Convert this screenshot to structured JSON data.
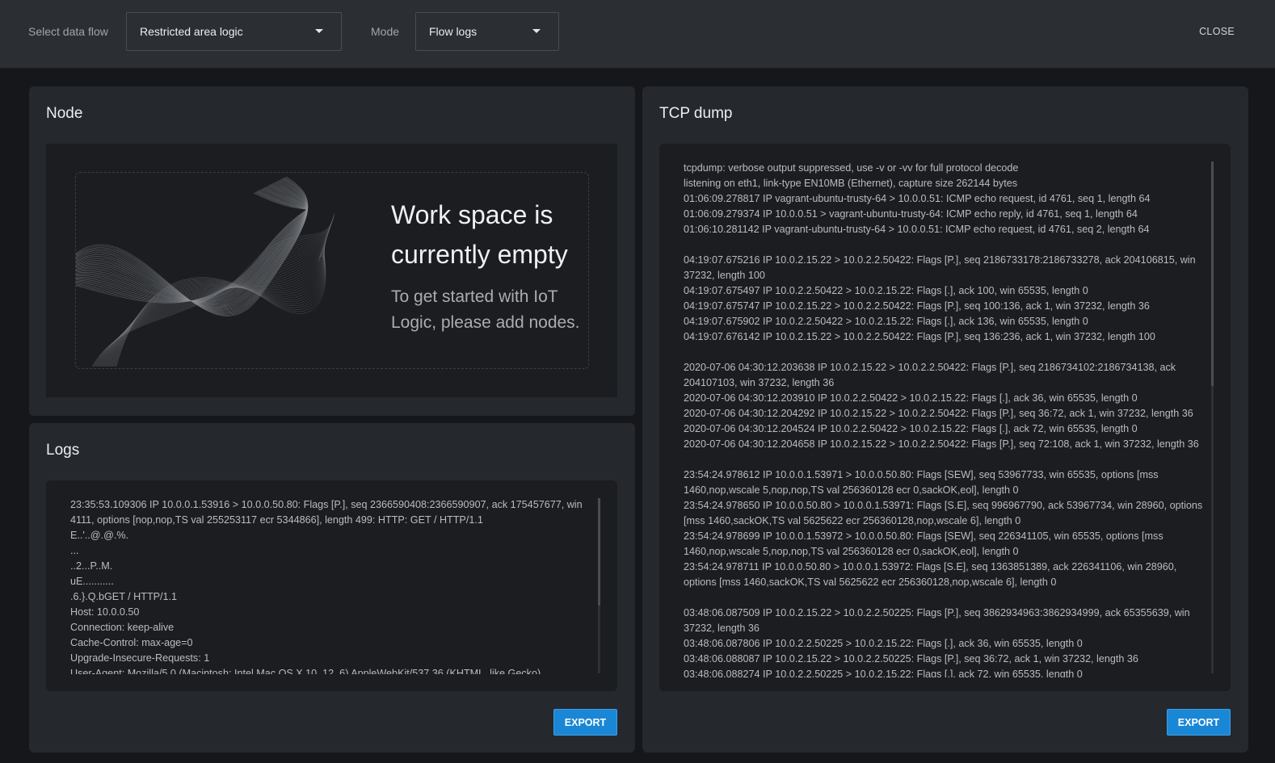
{
  "topbar": {
    "data_flow_label": "Select data flow",
    "data_flow_value": "Restricted area logic",
    "mode_label": "Mode",
    "mode_value": "Flow logs",
    "close_label": "CLOSE"
  },
  "node_panel": {
    "title": "Node",
    "empty_title": "Work space is currently empty",
    "empty_subtitle": "To get started with IoT Logic, please add nodes."
  },
  "logs_panel": {
    "title": "Logs",
    "content": "23:35:53.109306 IP 10.0.0.1.53916 > 10.0.0.50.80: Flags [P.], seq 2366590408:2366590907, ack 175457677, win 4111, options [nop,nop,TS val 255253117 ecr 5344866], length 499: HTTP: GET / HTTP/1.1\nE..'..@.@.%.\n...\n..2...P..M.\nuE...........\n.6.}.Q.bGET / HTTP/1.1\nHost: 10.0.0.50\nConnection: keep-alive\nCache-Control: max-age=0\nUpgrade-Insecure-Requests: 1\nUser-Agent: Mozilla/5.0 (Macintosh; Intel Mac OS X 10_12_6) AppleWebKit/537.36 (KHTML, like Gecko)",
    "export_label": "EXPORT"
  },
  "tcp_panel": {
    "title": "TCP dump",
    "content": "tcpdump: verbose output suppressed, use -v or -vv for full protocol decode\nlistening on eth1, link-type EN10MB (Ethernet), capture size 262144 bytes\n01:06:09.278817 IP vagrant-ubuntu-trusty-64 > 10.0.0.51: ICMP echo request, id 4761, seq 1, length 64\n01:06:09.279374 IP 10.0.0.51 > vagrant-ubuntu-trusty-64: ICMP echo reply, id 4761, seq 1, length 64\n01:06:10.281142 IP vagrant-ubuntu-trusty-64 > 10.0.0.51: ICMP echo request, id 4761, seq 2, length 64\n\n04:19:07.675216 IP 10.0.2.15.22 > 10.0.2.2.50422: Flags [P.], seq 2186733178:2186733278, ack 204106815, win 37232, length 100\n04:19:07.675497 IP 10.0.2.2.50422 > 10.0.2.15.22: Flags [.], ack 100, win 65535, length 0\n04:19:07.675747 IP 10.0.2.15.22 > 10.0.2.2.50422: Flags [P.], seq 100:136, ack 1, win 37232, length 36\n04:19:07.675902 IP 10.0.2.2.50422 > 10.0.2.15.22: Flags [.], ack 136, win 65535, length 0\n04:19:07.676142 IP 10.0.2.15.22 > 10.0.2.2.50422: Flags [P.], seq 136:236, ack 1, win 37232, length 100\n\n2020-07-06 04:30:12.203638 IP 10.0.2.15.22 > 10.0.2.2.50422: Flags [P.], seq 2186734102:2186734138, ack 204107103, win 37232, length 36\n2020-07-06 04:30:12.203910 IP 10.0.2.2.50422 > 10.0.2.15.22: Flags [.], ack 36, win 65535, length 0\n2020-07-06 04:30:12.204292 IP 10.0.2.15.22 > 10.0.2.2.50422: Flags [P.], seq 36:72, ack 1, win 37232, length 36\n2020-07-06 04:30:12.204524 IP 10.0.2.2.50422 > 10.0.2.15.22: Flags [.], ack 72, win 65535, length 0\n2020-07-06 04:30:12.204658 IP 10.0.2.15.22 > 10.0.2.2.50422: Flags [P.], seq 72:108, ack 1, win 37232, length 36\n\n23:54:24.978612 IP 10.0.0.1.53971 > 10.0.0.50.80: Flags [SEW], seq 53967733, win 65535, options [mss 1460,nop,wscale 5,nop,nop,TS val 256360128 ecr 0,sackOK,eol], length 0\n23:54:24.978650 IP 10.0.0.50.80 > 10.0.0.1.53971: Flags [S.E], seq 996967790, ack 53967734, win 28960, options [mss 1460,sackOK,TS val 5625622 ecr 256360128,nop,wscale 6], length 0\n23:54:24.978699 IP 10.0.0.1.53972 > 10.0.0.50.80: Flags [SEW], seq 226341105, win 65535, options [mss 1460,nop,wscale 5,nop,nop,TS val 256360128 ecr 0,sackOK,eol], length 0\n23:54:24.978711 IP 10.0.0.50.80 > 10.0.0.1.53972: Flags [S.E], seq 1363851389, ack 226341106, win 28960, options [mss 1460,sackOK,TS val 5625622 ecr 256360128,nop,wscale 6], length 0\n\n03:48:06.087509 IP 10.0.2.15.22 > 10.0.2.2.50225: Flags [P.], seq 3862934963:3862934999, ack 65355639, win 37232, length 36\n03:48:06.087806 IP 10.0.2.2.50225 > 10.0.2.15.22: Flags [.], ack 36, win 65535, length 0\n03:48:06.088087 IP 10.0.2.15.22 > 10.0.2.2.50225: Flags [P.], seq 36:72, ack 1, win 37232, length 36\n03:48:06.088274 IP 10.0.2.2.50225 > 10.0.2.15.22: Flags [.], ack 72, win 65535, length 0",
    "export_label": "EXPORT"
  },
  "colors": {
    "background": "#15171b",
    "topbar": "#2b2e33",
    "panel": "#25282d",
    "accent": "#1a87d6"
  }
}
